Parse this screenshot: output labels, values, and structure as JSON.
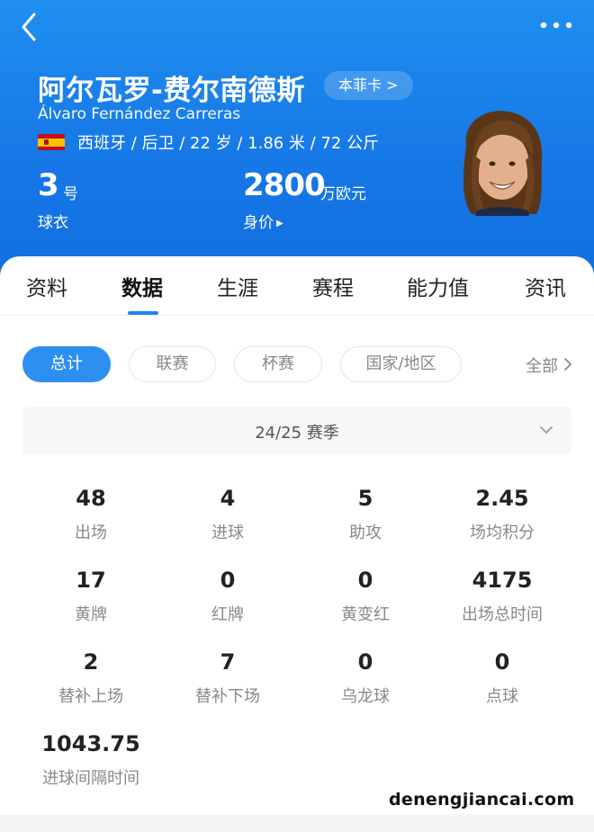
{
  "header": {
    "player_name": "阿尔瓦罗-费尔南德斯",
    "club_card": "本菲卡 >",
    "player_latin_name": "Álvaro Fernández Carreras",
    "info": "西班牙 / 后卫 / 22 岁 / 1.86 米 / 72 公斤",
    "jersey_number": "3",
    "jersey_unit": "号",
    "jersey_label": "球衣",
    "market_value": "2800",
    "market_value_unit": "万欧元",
    "market_value_label": "身价"
  },
  "tabs": [
    {
      "label": "资料"
    },
    {
      "label": "数据",
      "active": true
    },
    {
      "label": "生涯"
    },
    {
      "label": "赛程"
    },
    {
      "label": "能力值"
    },
    {
      "label": "资讯"
    }
  ],
  "filters": {
    "chips": [
      {
        "label": "总计",
        "active": true
      },
      {
        "label": "联赛"
      },
      {
        "label": "杯赛"
      },
      {
        "label": "国家/地区"
      }
    ],
    "all_label": "全部"
  },
  "season": "24/25 赛季",
  "stats": [
    {
      "value": "48",
      "label": "出场"
    },
    {
      "value": "4",
      "label": "进球"
    },
    {
      "value": "5",
      "label": "助攻"
    },
    {
      "value": "2.45",
      "label": "场均积分"
    },
    {
      "value": "17",
      "label": "黄牌"
    },
    {
      "value": "0",
      "label": "红牌"
    },
    {
      "value": "0",
      "label": "黄变红"
    },
    {
      "value": "4175",
      "label": "出场总时间"
    },
    {
      "value": "2",
      "label": "替补上场"
    },
    {
      "value": "7",
      "label": "替补下场"
    },
    {
      "value": "0",
      "label": "乌龙球"
    },
    {
      "value": "0",
      "label": "点球"
    },
    {
      "value": "1043.75",
      "label": "进球间隔时间"
    }
  ],
  "watermark": "denengjiancai.com",
  "colors": {
    "header_blue": "#1677e6",
    "accent": "#2d8ff0",
    "tab_indicator": "#1a86f0"
  },
  "icons": [
    "back-arrow-icon",
    "more-dots-icon",
    "spain-flag-icon",
    "chevron-right-icon",
    "chevron-down-icon"
  ]
}
